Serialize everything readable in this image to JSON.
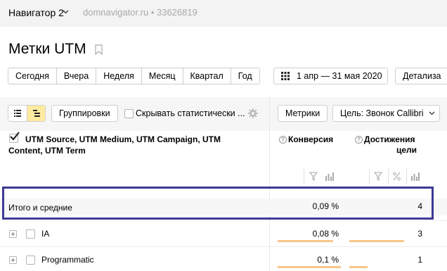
{
  "header": {
    "counter_name": "Навигатор 2",
    "counter_meta": "domnavigator.ru • 33626819"
  },
  "page": {
    "title": "Метки UTM"
  },
  "periods": [
    "Сегодня",
    "Вчера",
    "Неделя",
    "Месяц",
    "Квартал",
    "Год"
  ],
  "date_range": "1 апр — 31 мая 2020",
  "detail_label": "Детализа",
  "toolbar": {
    "group_label": "Группировки",
    "hide_stats_label": "Скрывать статистически ...",
    "metrics_label": "Метрики",
    "goal_label": "Цель: Звонок Callibri"
  },
  "table": {
    "dimensions_label": "UTM Source, UTM Medium, UTM Campaign, UTM Content, UTM Term",
    "metric1": "Конверсия",
    "metric2_line1": "Достижения",
    "metric2_line2": "цели",
    "total_label": "Итого и средние",
    "total_conv": "0,09 %",
    "total_goals": "4",
    "rows": [
      {
        "label": "IA",
        "conv": "0,08 %",
        "goals": "3",
        "conv_share": 0.88,
        "goal_share": 0.75
      },
      {
        "label": "Programmatic",
        "conv": "0,1 %",
        "goals": "1",
        "conv_share": 1.0,
        "goal_share": 0.25
      }
    ]
  },
  "colors": {
    "highlight_border": "#3d3a94",
    "bar": "#f6c68a",
    "active_toggle": "#ffeba0"
  }
}
